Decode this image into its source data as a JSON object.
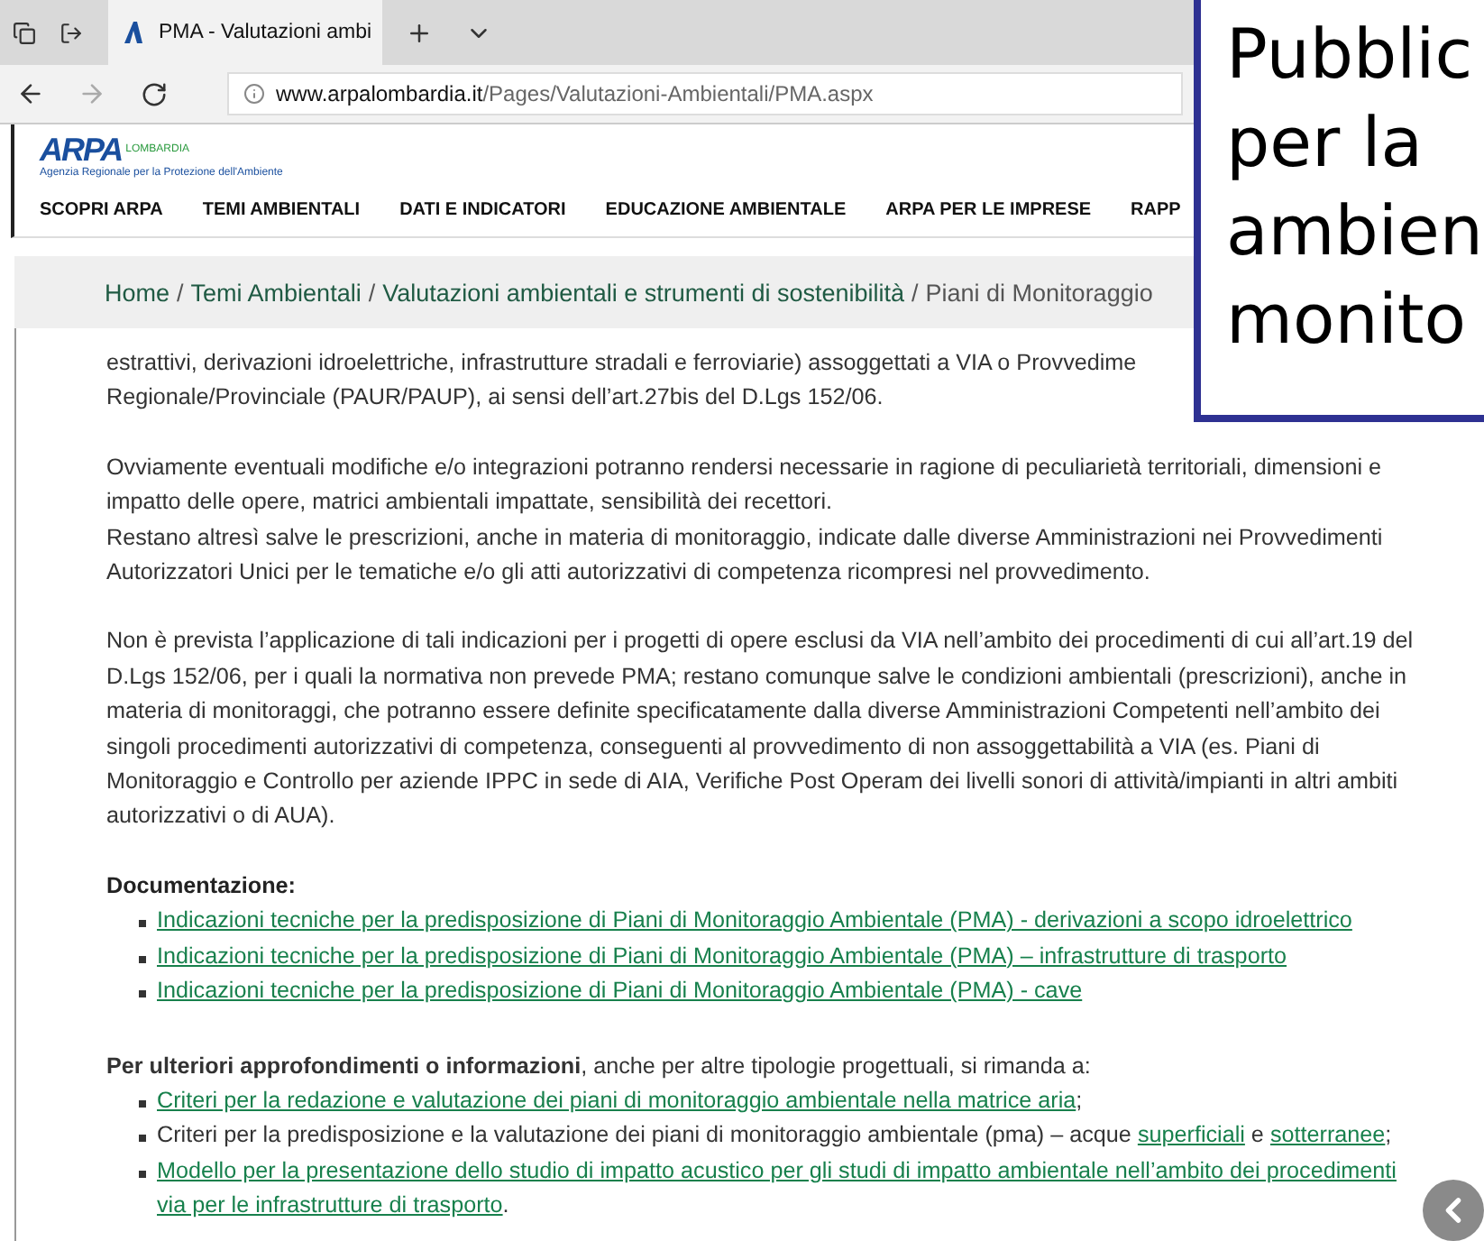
{
  "browser": {
    "tabs": [
      {
        "title": "PMA - Valutazioni ambi",
        "selected": true
      }
    ],
    "url": {
      "domain": "www.arpalombardia.it",
      "path": "/Pages/Valutazioni-Ambientali/PMA.aspx"
    }
  },
  "site": {
    "logo": {
      "name": "ARPA",
      "region": "LOMBARDIA",
      "tagline": "Agenzia Regionale per la Protezione dell'Ambiente"
    },
    "nav": [
      "SCOPRI ARPA",
      "TEMI AMBIENTALI",
      "DATI E INDICATORI",
      "EDUCAZIONE AMBIENTALE",
      "ARPA PER LE IMPRESE",
      "RAPP"
    ]
  },
  "breadcrumb": {
    "separator": "/",
    "items": [
      {
        "label": "Home",
        "current": false
      },
      {
        "label": "Temi Ambientali",
        "current": false
      },
      {
        "label": "Valutazioni ambientali e strumenti di sostenibilità",
        "current": false
      },
      {
        "label": "Piani di Monitoraggio",
        "current": true
      }
    ]
  },
  "paragraphs": [
    {
      "lines": [
        "estrattivi, derivazioni idroelettriche, infrastrutture stradali e ferroviarie) assoggettati a VIA o Provvedime",
        "Regionale/Provinciale (PAUR/PAUP), ai sensi dell’art.27bis del D.Lgs 152/06."
      ]
    },
    {
      "lines": [
        "Ovviamente eventuali modifiche e/o integrazioni potranno rendersi necessarie in ragione di peculiarietà territoriali, dimensioni e",
        "impatto delle opere, matrici ambientali impattate, sensibilità dei recettori.",
        "Restano altresì salve le prescrizioni, anche in materia di monitoraggio, indicate dalle diverse Amministrazioni nei Provvedimenti",
        "Autorizzatori Unici per le tematiche e/o gli atti autorizzativi di competenza ricompresi nel provvedimento."
      ]
    },
    {
      "lines": [
        "Non è prevista l’applicazione di tali indicazioni per i progetti di opere esclusi da VIA nell’ambito dei procedimenti di cui all’art.19 del",
        "D.Lgs 152/06, per i quali la normativa non prevede  PMA; restano comunque salve le condizioni ambientali (prescrizioni), anche in",
        "materia di monitoraggi, che potranno essere definite specificatamente dalla diverse Amministrazioni Competenti nell’ambito dei",
        "singoli procedimenti autorizzativi di competenza, conseguenti al provvedimento di non assoggettabilità a VIA (es. Piani di",
        "Monitoraggio e Controllo per aziende IPPC in sede di AIA, Verifiche Post Operam dei livelli sonori di attività/impianti in altri ambiti",
        "autorizzativi o  di AUA)."
      ]
    }
  ],
  "documentation": {
    "heading": "Documentazione:",
    "links": [
      "Indicazioni tecniche  per la predisposizione di Piani di Monitoraggio Ambientale (PMA) - derivazioni a scopo idroelettrico",
      "Indicazioni tecniche per la predisposizione di Piani di Monitoraggio Ambientale (PMA) – infrastrutture di trasporto",
      "Indicazioni tecniche  per la predisposizione di Piani di Monitoraggio Ambientale (PMA) - cave"
    ]
  },
  "further": {
    "intro": "**Per ulteriori approfondimenti o informazioni**, anche per altre tipologie progettuali, si rimanda a:",
    "items": [
      {
        "lines": [
          [
            {
              "text": "Criteri per la redazione e valutazione dei piani di monitoraggio ambientale nella matrice aria",
              "link": true
            },
            {
              "text": ";",
              "link": false
            }
          ]
        ]
      },
      {
        "lines": [
          [
            {
              "text": "Criteri per la predisposizione e la valutazione dei piani di monitoraggio ambientale (pma) – acque ",
              "link": false
            },
            {
              "text": "superficiali",
              "link": true
            },
            {
              "text": " e ",
              "link": false
            },
            {
              "text": "sotterranee",
              "link": true
            },
            {
              "text": ";",
              "link": false
            }
          ]
        ]
      },
      {
        "lines": [
          [
            {
              "text": "Modello per la presentazione dello studio di impatto acustico per gli studi di impatto ambientale nell’ambito dei procedimenti",
              "link": true
            }
          ],
          [
            {
              "text": "via per le infrastrutture di trasporto",
              "link": true
            },
            {
              "text": ".",
              "link": false
            }
          ]
        ]
      }
    ]
  },
  "callout": {
    "lines": [
      "Pubblic",
      "per la",
      "ambien",
      "monito"
    ]
  }
}
